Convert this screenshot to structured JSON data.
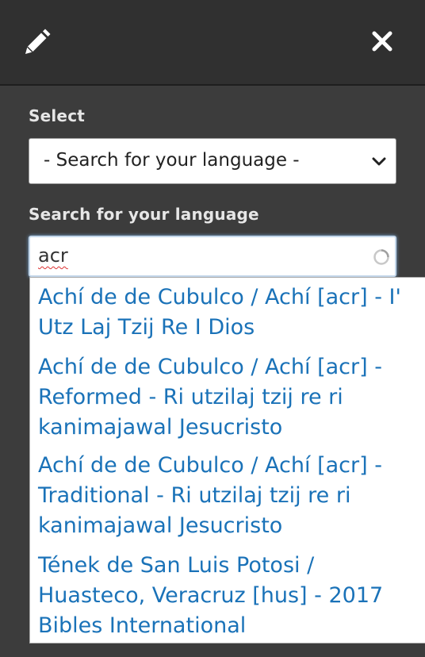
{
  "header": {
    "edit_icon": "pencil-icon",
    "close_icon": "close-icon"
  },
  "form": {
    "select_label": "Select",
    "select_value": "- Search for your language -",
    "search_label": "Search for your language",
    "search_value": "acr"
  },
  "results": [
    {
      "label": "Achí de de Cubulco / Achí [acr] - I' Utz Laj Tzij Re I Dios"
    },
    {
      "label": "Achí de de Cubulco / Achí [acr] - Reformed - Ri utzilaj tzij re ri kanimajawal Jesucristo"
    },
    {
      "label": "Achí de de Cubulco / Achí [acr] - Traditional - Ri utzilaj tzij re ri kanimajawal Jesucristo"
    },
    {
      "label": "Tének de San Luis Potosi / Huasteco, Veracruz [hus] - 2017 Bibles International"
    }
  ],
  "colors": {
    "header_bg": "#303030",
    "panel_bg": "#3c3c3c",
    "link": "#1a72b8",
    "label": "#e6e6e6"
  }
}
